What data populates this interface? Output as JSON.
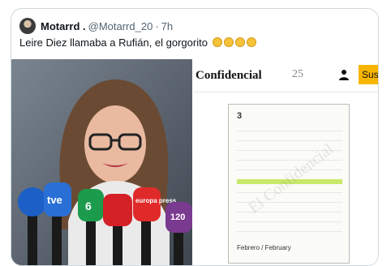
{
  "tweet": {
    "display_name": "Motarrd .",
    "handle": "@Motarrd_20",
    "separator": "·",
    "time": "7h",
    "text": "Leire Diez llamaba a Rufián, el gorgorito"
  },
  "emoji": {
    "icon": "rofl-emoji",
    "count": 4
  },
  "left_image": {
    "mic_labels": [
      "tve",
      "6",
      "europa press",
      "120"
    ]
  },
  "right_image": {
    "masthead": "Confidencial",
    "masthead_number": "25",
    "subscribe_label": "Sus",
    "notebook_page_number": "3",
    "notebook_month": "Febrero / February",
    "watermark": "El Confidencial"
  },
  "colors": {
    "card_border": "#cfd9de",
    "name_color": "#0f1419",
    "meta_color": "#536471",
    "subscribe_bg": "#f7b500"
  }
}
